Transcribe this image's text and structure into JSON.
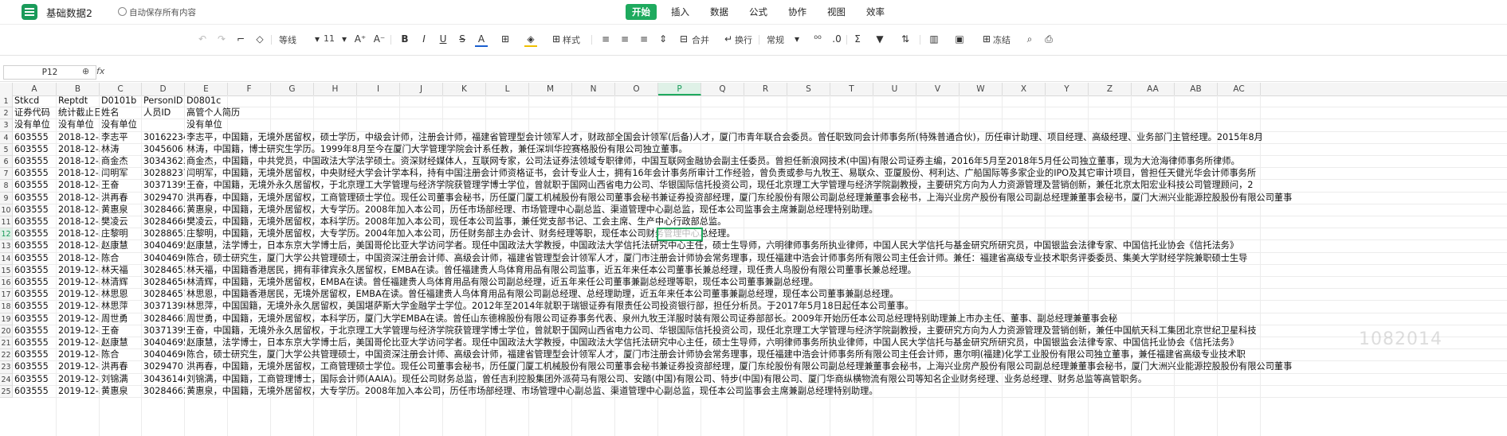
{
  "app": {
    "doc_title": "基础数据2",
    "autosave": "自动保存所有内容"
  },
  "menu": [
    "开始",
    "插入",
    "数据",
    "公式",
    "协作",
    "视图",
    "效率"
  ],
  "menu_active": 0,
  "toolbar": {
    "font_name": "等线",
    "font_size": "11",
    "style_label": "样式",
    "merge_label": "合并",
    "wrap_label": "换行",
    "number_format": "常规",
    "freeze_label": "冻结"
  },
  "formula_bar": {
    "name_box": "P12",
    "fx": "fx"
  },
  "columns": [
    "A",
    "B",
    "C",
    "D",
    "E",
    "F",
    "G",
    "H",
    "I",
    "J",
    "K",
    "L",
    "M",
    "N",
    "O",
    "P",
    "Q",
    "R",
    "S",
    "T",
    "U",
    "V",
    "W",
    "X",
    "Y",
    "Z",
    "AA",
    "AB",
    "AC"
  ],
  "selected_column": "P",
  "selected_row": "12",
  "watermark": "1082014",
  "rows": [
    {
      "n": "1",
      "a": "Stkcd",
      "b": "Reptdt",
      "c": "D0101b",
      "d": "PersonID",
      "e": "D0801c"
    },
    {
      "n": "2",
      "a": "证券代码",
      "b": "统计截止日",
      "c": "姓名",
      "d": "人员ID",
      "e": "高管个人简历"
    },
    {
      "n": "3",
      "a": "没有单位",
      "b": "没有单位",
      "c": "没有单位",
      "d": "",
      "e": "没有单位"
    },
    {
      "n": "4",
      "a": "603555",
      "b": "2018-12-3",
      "c": "李志平",
      "d": "30162234",
      "e": "李志平，中国籍，无境外居留权，硕士学历，中级会计师，注册会计师，福建省管理型会计领军人才，财政部全国会计领军(后备)人才，厦门市青年联合会委员。曾任职致同会计师事务所(特殊普通合伙)，历任审计助理、项目经理、高级经理、业务部门主管经理。2015年8月"
    },
    {
      "n": "5",
      "a": "603555",
      "b": "2018-12-3",
      "c": "林涛",
      "d": "3045606",
      "e": "林涛，中国籍，博士研究生学历。1999年8月至今在厦门大学管理学院会计系任教，兼任深圳华控赛格股份有限公司独立董事。"
    },
    {
      "n": "6",
      "a": "603555",
      "b": "2018-12-3",
      "c": "商金杰",
      "d": "30343623",
      "e": "商金杰，中国籍，中共党员，中国政法大学法学硕士。资深财经媒体人，互联网专家，公司法证券法领域专职律师，中国互联网金融协会副主任委员。曾担任新浪网技术(中国)有限公司证券主编，2016年5月至2018年5月任公司独立董事，现为大沧海律师事务所律师。"
    },
    {
      "n": "7",
      "a": "603555",
      "b": "2018-12-3",
      "c": "闫明军",
      "d": "30288237",
      "e": "闫明军，中国籍，无境外居留权，中央财经大学会计学本科，持有中国注册会计师资格证书，会计专业人士，拥有16年会计事务所审计工作经验，曾负责或参与九牧王、易联众、亚厦股份、柯利达、广船国际等多家企业的IPO及其它审计项目，曾担任天健光华会计师事务所"
    },
    {
      "n": "8",
      "a": "603555",
      "b": "2018-12-3",
      "c": "王奋",
      "d": "30371399",
      "e": "王奋，中国籍，无境外永久居留权，于北京理工大学管理与经济学院获管理学博士学位，曾就职于国网山西省电力公司、华银国际信托投资公司，现任北京理工大学管理与经济学院副教授，主要研究方向为人力资源管理及营销创新，兼任北京太阳宏业科技公司管理顾问，2"
    },
    {
      "n": "9",
      "a": "603555",
      "b": "2018-12-3",
      "c": "洪再春",
      "d": "3029470",
      "e": "洪再春，中国籍，无境外居留权，工商管理硕士学位。现任公司董事会秘书，历任厦门厦工机械股份有限公司董事会秘书兼证券投资部经理，厦门东纶股份有限公司副总经理兼董事会秘书，上海兴业房产股份有限公司副总经理兼董事会秘书，厦门大洲兴业能源控股股份有限公司董事"
    },
    {
      "n": "10",
      "a": "603555",
      "b": "2018-12-3",
      "c": "黄惠泉",
      "d": "30284662",
      "e": "黄惠泉，中国籍，无境外居留权，大专学历。2008年加入本公司，历任市场部经理、市场管理中心副总监、渠道管理中心副总监，现任本公司监事会主席兼副总经理特别助理。"
    },
    {
      "n": "11",
      "a": "603555",
      "b": "2018-12-3",
      "c": "樊凌云",
      "d": "30284666",
      "e": "樊凌云，中国籍，无境外居留权，本科学历。2008年加入本公司，现任本公司监事，兼任党支部书记、工会主席、生产中心行政部总监。"
    },
    {
      "n": "12",
      "a": "603555",
      "b": "2018-12-3",
      "c": "庄黎明",
      "d": "30288653",
      "e": "庄黎明，中国籍，无境外居留权，大专学历。2004年加入本公司，历任财务部主办会计、财务经理等职，现任本公司财务管理中心总经理。"
    },
    {
      "n": "13",
      "a": "603555",
      "b": "2018-12-3",
      "c": "赵康慧",
      "d": "30404695",
      "e": "赵康慧，法学博士，日本东京大学博士后，美国哥伦比亚大学访问学者。现任中国政法大学教授，中国政法大学信托法研究中心主任，硕士生导师，六明律师事务所执业律师，中国人民大学信托与基金研究所研究员，中国银监会法律专家、中国信托业协会《信托法务》"
    },
    {
      "n": "14",
      "a": "603555",
      "b": "2018-12-3",
      "c": "陈合",
      "d": "30404696",
      "e": "陈合，硕士研究生，厦门大学公共管理硕士，中国资深注册会计师、高级会计师，福建省管理型会计领军人才，厦门市注册会计师协会常务理事，现任福建中浩会计师事务所有限公司主任会计师。兼任：福建省高级专业技术职务评委委员、集美大学财经学院兼职硕士生导"
    },
    {
      "n": "15",
      "a": "603555",
      "b": "2019-12-3",
      "c": "林天福",
      "d": "30284653",
      "e": "林天福，中国籍香港居民，拥有菲律宾永久居留权，EMBA在读。曾任福建贵人鸟体育用品有限公司监事，近五年来任本公司董事长兼总经理，现任贵人鸟股份有限公司董事长兼总经理。"
    },
    {
      "n": "16",
      "a": "603555",
      "b": "2019-12-3",
      "c": "林清辉",
      "d": "30284656",
      "e": "林清辉，中国籍，无境外居留权，EMBA在读。曾任福建贵人鸟体育用品有限公司副总经理，近五年来任公司董事兼副总经理等职，现任本公司董事兼副总经理。"
    },
    {
      "n": "17",
      "a": "603555",
      "b": "2019-12-3",
      "c": "林思恩",
      "d": "30284657",
      "e": "林思恩，中国籍香港居民，无境外居留权，EMBA在读。曾任福建贵人鸟体育用品有限公司副总经理、总经理助理，近五年来任本公司董事兼副总经理，现任本公司董事兼副总经理。"
    },
    {
      "n": "18",
      "a": "603555",
      "b": "2019-12-3",
      "c": "林思萍",
      "d": "30371398",
      "e": "林思萍，中国国籍，无境外永久居留权，美国堪萨斯大学金融学士学位。2012年至2014年就职于瑞银证券有限责任公司投资银行部，担任分析员。于2017年5月18日起任本公司董事。"
    },
    {
      "n": "19",
      "a": "603555",
      "b": "2019-12-3",
      "c": "周世勇",
      "d": "30284661",
      "e": "周世勇，中国籍，无境外居留权，本科学历，厦门大学EMBA在读。曾任山东德棉股份有限公司证券事务代表、泉州九牧王洋服时装有限公司证券部部长。2009年开始历任本公司总经理特别助理兼上市办主任、董事、副总经理兼董事会秘"
    },
    {
      "n": "20",
      "a": "603555",
      "b": "2019-12-3",
      "c": "王奋",
      "d": "30371399",
      "e": "王奋，中国籍，无境外永久居留权，于北京理工大学管理与经济学院获管理学博士学位，曾就职于国网山西省电力公司、华银国际信托投资公司，现任北京理工大学管理与经济学院副教授，主要研究方向为人力资源管理及营销创新，兼任中国航天科工集团北京世纪卫星科技"
    },
    {
      "n": "21",
      "a": "603555",
      "b": "2019-12-3",
      "c": "赵康慧",
      "d": "30404695",
      "e": "赵康慧，法学博士，日本东京大学博士后，美国哥伦比亚大学访问学者。现任中国政法大学教授，中国政法大学信托法研究中心主任，硕士生导师，六明律师事务所执业律师，中国人民大学信托与基金研究所研究员，中国银监会法律专家、中国信托业协会《信托法务》"
    },
    {
      "n": "22",
      "a": "603555",
      "b": "2019-12-3",
      "c": "陈合",
      "d": "30404696",
      "e": "陈合，硕士研究生，厦门大学公共管理硕士，中国资深注册会计师、高级会计师，福建省管理型会计领军人才，厦门市注册会计师协会常务理事，现任福建中浩会计师事务所有限公司主任会计师，惠尔明(福建)化学工业股份有限公司独立董事，兼任福建省高级专业技术职"
    },
    {
      "n": "23",
      "a": "603555",
      "b": "2019-12-3",
      "c": "洪再春",
      "d": "3029470",
      "e": "洪再春，中国籍，无境外居留权，工商管理硕士学位。现任公司董事会秘书，历任厦门厦工机械股份有限公司董事会秘书兼证券投资部经理，厦门东纶股份有限公司副总经理兼董事会秘书，上海兴业房产股份有限公司副总经理兼董事会秘书，厦门大洲兴业能源控股股份有限公司董事"
    },
    {
      "n": "24",
      "a": "603555",
      "b": "2019-12-3",
      "c": "刘锦满",
      "d": "30436146",
      "e": "刘锦满，中国籍，工商管理博士，国际会计师(AAIA)。现任公司财务总监，曾任吉利控股集团外派荷马有限公司、安踏(中国)有限公司、特步(中国)有限公司、厦门华商纵横物流有限公司等知名企业财务经理、业务总经理、财务总监等高管职务。"
    },
    {
      "n": "25",
      "a": "603555",
      "b": "2019-12-3",
      "c": "黄惠泉",
      "d": "30284662",
      "e": "黄惠泉，中国籍，无境外居留权，大专学历。2008年加入本公司，历任市场部经理、市场管理中心副总监、渠道管理中心副总监，现任本公司监事会主席兼副总经理特别助理。"
    }
  ]
}
